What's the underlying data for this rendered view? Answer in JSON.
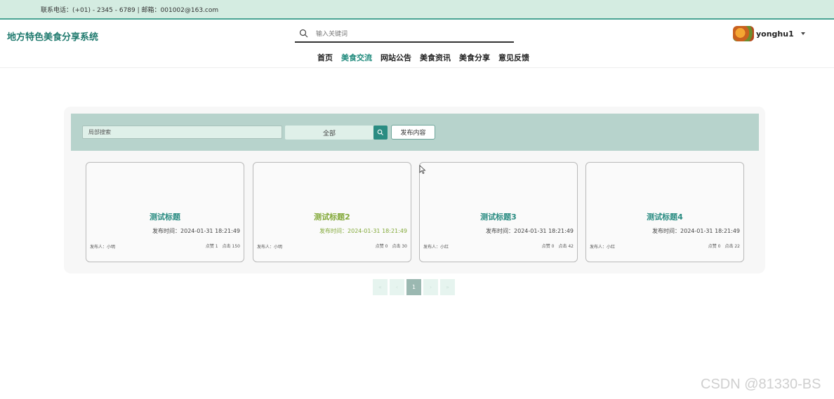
{
  "topbar": {
    "contact": "联系电话：(+01) - 2345 - 6789 | 邮箱：001002@163.com"
  },
  "header": {
    "site_title": "地方特色美食分享系统",
    "search_placeholder": "输入关键词",
    "user_name": "yonghu1"
  },
  "nav": {
    "items": [
      {
        "label": "首页"
      },
      {
        "label": "美食交流"
      },
      {
        "label": "网站公告"
      },
      {
        "label": "美食资讯"
      },
      {
        "label": "美食分享"
      },
      {
        "label": "意见反馈"
      }
    ],
    "active": "美食交流"
  },
  "filters": {
    "local_search_placeholder": "局部搜索",
    "category_value": "全部",
    "publish_label": "发布内容"
  },
  "cards": [
    {
      "title": "测试标题",
      "time": "发布时间：2024-01-31 18:21:49",
      "author": "发布人：小明",
      "likes": "点赞 1",
      "clicks": "点击 150"
    },
    {
      "title": "测试标题2",
      "time": "发布时间：2024-01-31 18:21:49",
      "author": "发布人：小明",
      "likes": "点赞 0",
      "clicks": "点击 30"
    },
    {
      "title": "测试标题3",
      "time": "发布时间：2024-01-31 18:21:49",
      "author": "发布人：小红",
      "likes": "点赞 0",
      "clicks": "点击 42"
    },
    {
      "title": "测试标题4",
      "time": "发布时间：2024-01-31 18:21:49",
      "author": "发布人：小红",
      "likes": "点赞 0",
      "clicks": "点击 22"
    }
  ],
  "pagination": {
    "first": "«",
    "prev": "‹",
    "current": "1",
    "next": "›",
    "last": "»"
  },
  "watermark": "CSDN @81330-BS",
  "colors": {
    "accent": "#2a8c82",
    "topbar_bg": "#d4ece1",
    "filter_bar_bg": "#b7d3cc",
    "alt_title": "#83a93a"
  }
}
